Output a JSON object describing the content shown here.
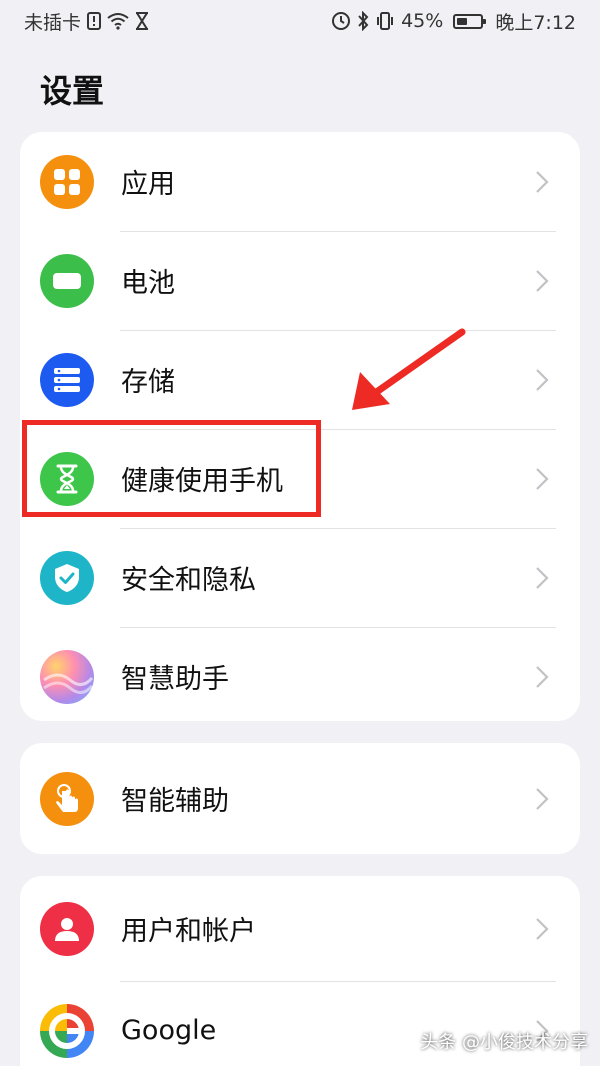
{
  "status_bar": {
    "carrier": "未插卡",
    "battery_percent": "45%",
    "battery_level": 0.45,
    "time": "晚上7:12"
  },
  "page": {
    "title": "设置"
  },
  "groups": [
    {
      "items": [
        {
          "label": "应用",
          "icon": "apps-icon",
          "color": "#f5900f"
        },
        {
          "label": "电池",
          "icon": "battery-icon",
          "color": "#3cbf4a"
        },
        {
          "label": "存储",
          "icon": "storage-icon",
          "color": "#1d5bf0"
        },
        {
          "label": "健康使用手机",
          "icon": "hourglass-icon",
          "color": "#3dc64a"
        },
        {
          "label": "安全和隐私",
          "icon": "shield-icon",
          "color": "#1fb5c8"
        },
        {
          "label": "智慧助手",
          "icon": "assistant-icon",
          "color": "#b389e8"
        }
      ]
    },
    {
      "items": [
        {
          "label": "智能辅助",
          "icon": "hand-tap-icon",
          "color": "#f5900f"
        }
      ]
    },
    {
      "items": [
        {
          "label": "用户和帐户",
          "icon": "user-icon",
          "color": "#ee2f45"
        },
        {
          "label": "Google",
          "icon": "google-icon",
          "color": "#4285f4"
        }
      ]
    }
  ],
  "annotation": {
    "highlight_color": "#ee2a24"
  },
  "watermark": "头条 @小俊技术分享"
}
